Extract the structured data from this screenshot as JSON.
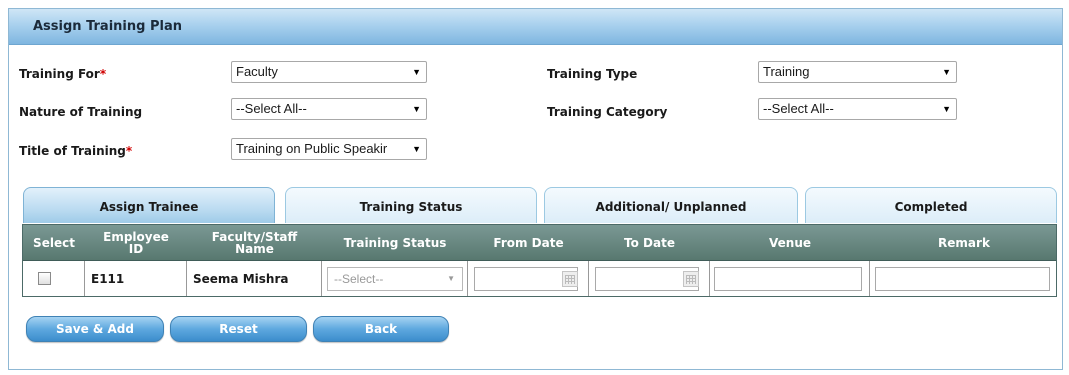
{
  "header": {
    "title": "Assign Training Plan"
  },
  "form": {
    "training_for": {
      "label": "Training For",
      "required_mark": "*",
      "value": "Faculty"
    },
    "training_type": {
      "label": "Training Type",
      "value": "Training"
    },
    "nature_of_training": {
      "label": "Nature of Training",
      "value": "--Select All--"
    },
    "training_category": {
      "label": "Training Category",
      "value": "--Select All--"
    },
    "title_of_training": {
      "label": "Title of Training",
      "required_mark": "*",
      "value": "Training on Public Speakir"
    }
  },
  "tabs": [
    {
      "label": "Assign Trainee",
      "active": true
    },
    {
      "label": "Training Status",
      "active": false
    },
    {
      "label": "Additional/ Unplanned",
      "active": false
    },
    {
      "label": "Completed",
      "active": false
    }
  ],
  "table": {
    "columns": {
      "select": "Select",
      "employee_id": "Employee ID",
      "faculty_staff_name": "Faculty/Staff Name",
      "training_status": "Training Status",
      "from_date": "From Date",
      "to_date": "To Date",
      "venue": "Venue",
      "remark": "Remark"
    },
    "rows": [
      {
        "checked": false,
        "employee_id": "E111",
        "name": "Seema Mishra",
        "training_status": "--Select--",
        "from_date": "",
        "to_date": "",
        "venue": "",
        "remark": ""
      }
    ]
  },
  "buttons": {
    "save_add": "Save & Add",
    "reset": "Reset",
    "back": "Back"
  },
  "colors": {
    "header_gradient": "#a9d1ee",
    "grid_header": "#668580",
    "button": "#4f9bd6",
    "required": "#d00000"
  }
}
